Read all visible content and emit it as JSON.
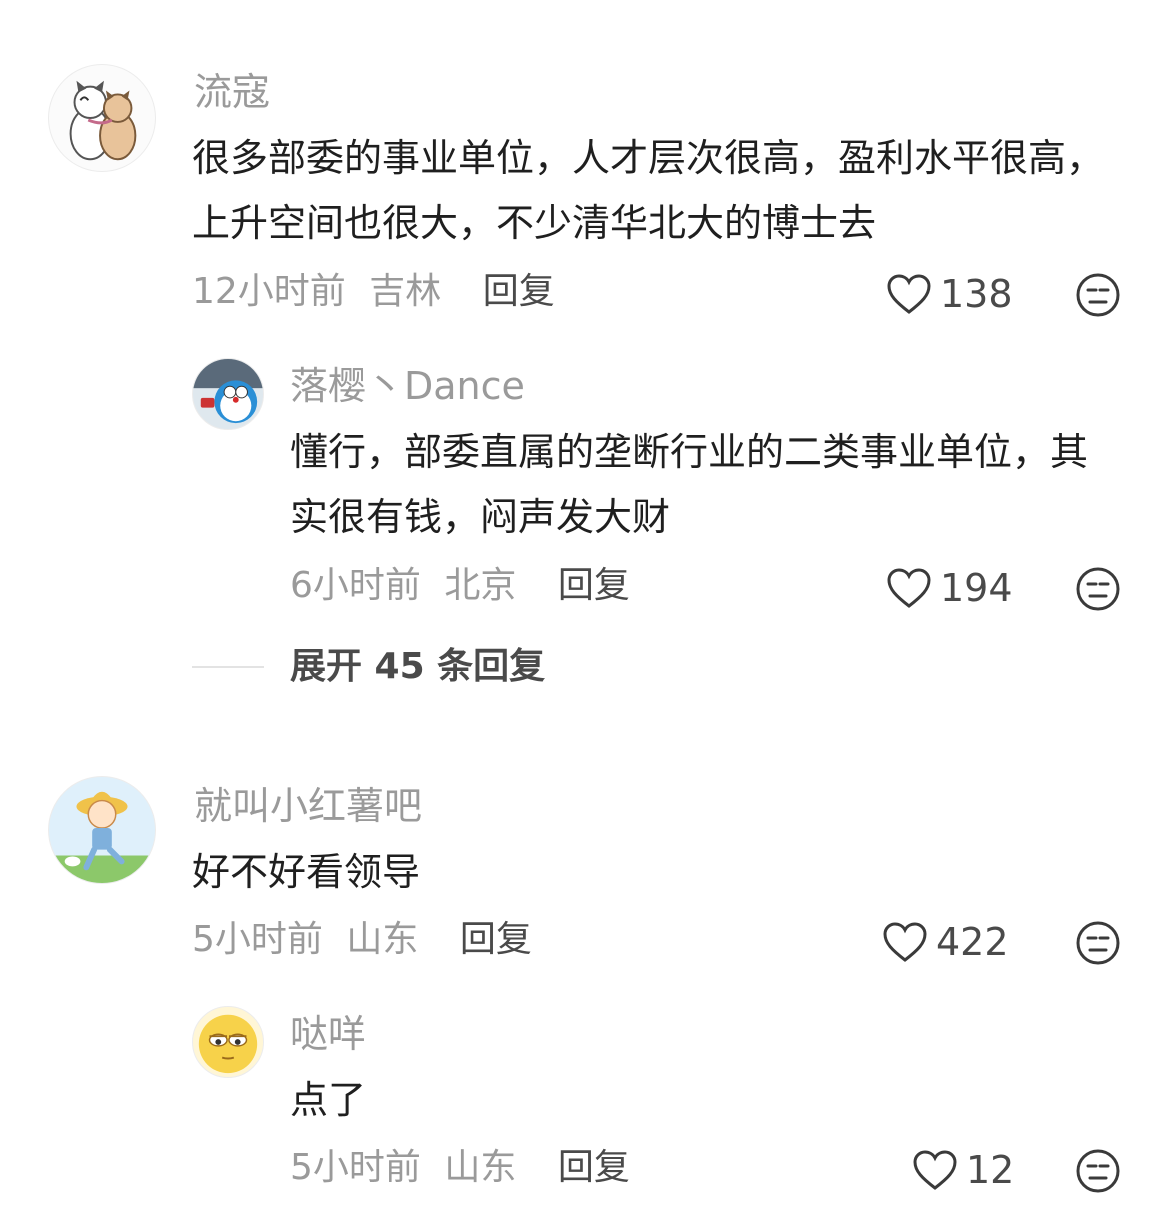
{
  "comments": [
    {
      "author": "流寇",
      "text": "很多部委的事业单位，人才层次很高，盈利水平很高，上升空间也很大，不少清华北大的博士去",
      "time": "12小时前",
      "location": "吉林",
      "reply_label": "回复",
      "likes": "138",
      "avatar": "cats-avatar"
    },
    {
      "author": "落樱丶Dance",
      "text": "懂行，部委直属的垄断行业的二类事业单位，其实很有钱，闷声发大财",
      "time": "6小时前",
      "location": "北京",
      "reply_label": "回复",
      "likes": "194",
      "avatar": "doraemon-avatar"
    },
    {
      "author": "就叫小红薯吧",
      "text": "好不好看领导",
      "time": "5小时前",
      "location": "山东",
      "reply_label": "回复",
      "likes": "422",
      "avatar": "girl-avatar"
    },
    {
      "author": "哒咩",
      "text": "点了",
      "time": "5小时前",
      "location": "山东",
      "reply_label": "回复",
      "likes": "12",
      "avatar": "emoji-face-avatar"
    }
  ],
  "expand_replies": "展开 45 条回复",
  "icons": {
    "like": "heart-icon",
    "reaction": "neutral-face-icon"
  },
  "colors": {
    "author": "#9a9a9a",
    "text": "#1f1f1f",
    "action": "#4a4a4a"
  }
}
